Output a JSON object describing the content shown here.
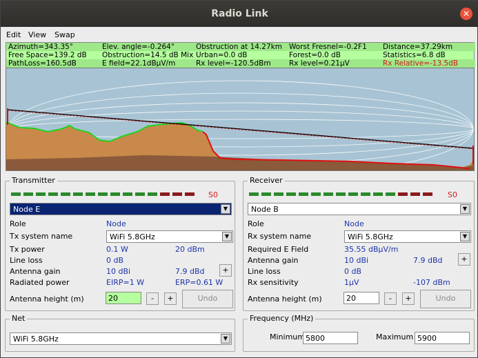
{
  "window": {
    "title": "Radio Link",
    "close_icon": "close-icon"
  },
  "menu": {
    "edit": "Edit",
    "view": "View",
    "swap": "Swap"
  },
  "info": {
    "row1": [
      "Azimuth=343.35°",
      "Elev. angle=-0.264°",
      "Obstruction at 14.27km",
      "Worst Fresnel=-0.2F1",
      "Distance=37.29km"
    ],
    "row2": [
      "Free Space=139.2 dB",
      "Obstruction=14.5 dB Mix",
      "Urban=0.0 dB",
      "Forest=0.0 dB",
      "Statistics=6.8 dB"
    ],
    "row3": [
      "PathLoss=160.5dB",
      "E field=22.1dBµV/m",
      "Rx level=-120.5dBm",
      "Rx level=0.21µV",
      "Rx Relative=-13.5dB"
    ]
  },
  "transmitter": {
    "legend": "Transmitter",
    "signal": "S0",
    "node": "Node E",
    "role_label": "Role",
    "role": "Node",
    "system_label": "Tx system name",
    "system": "WiFi 5.8GHz",
    "power_label": "Tx power",
    "power_w": "0.1 W",
    "power_dbm": "20 dBm",
    "loss_label": "Line loss",
    "loss": "0 dB",
    "gain_label": "Antenna gain",
    "gain_dbi": "10 dBi",
    "gain_dbd": "7.9 dBd",
    "radiated_label": "Radiated power",
    "eirp": "EIRP=1 W",
    "erp": "ERP=0.61 W",
    "height_label": "Antenna height (m)",
    "height": "20",
    "minus": "-",
    "plus": "+",
    "undo": "Undo",
    "gain_plus": "+"
  },
  "receiver": {
    "legend": "Receiver",
    "signal": "S0",
    "node": "Node B",
    "role_label": "Role",
    "role": "Node",
    "system_label": "Rx system name",
    "system": "WiFi 5.8GHz",
    "field_label": "Required E Field",
    "field": "35.55 dBµV/m",
    "gain_label": "Antenna gain",
    "gain_dbi": "10 dBi",
    "gain_dbd": "7.9 dBd",
    "loss_label": "Line loss",
    "loss": "0 dB",
    "sens_label": "Rx sensitivity",
    "sens_uv": "1µV",
    "sens_dbm": "-107 dBm",
    "height_label": "Antenna height (m)",
    "height": "20",
    "minus": "-",
    "plus": "+",
    "undo": "Undo",
    "gain_plus": "+"
  },
  "net": {
    "legend": "Net",
    "value": "WiFi 5.8GHz"
  },
  "frequency": {
    "legend": "Frequency (MHz)",
    "min_label": "Minimum",
    "min": "5800",
    "max_label": "Maximum",
    "max": "5900"
  },
  "colors": {
    "info_bg": "#b5ff9e",
    "terrain": "#c8894a",
    "sky": "#a8c4d4",
    "alert": "#d01a1a",
    "selection": "#0a2472"
  }
}
